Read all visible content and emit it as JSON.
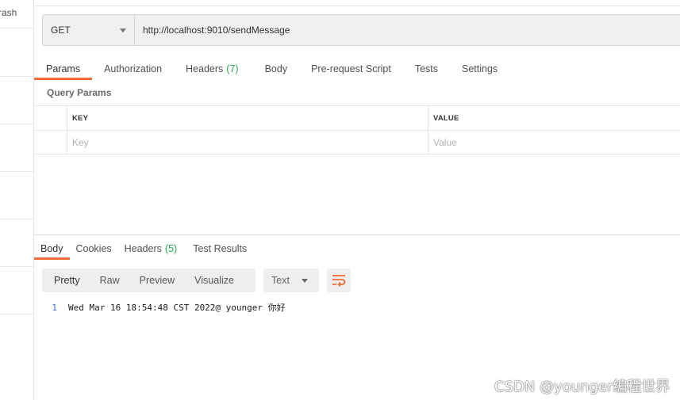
{
  "sidebar": {
    "partial_label": "rash"
  },
  "request": {
    "method": "GET",
    "url": "http://localhost:9010/sendMessage",
    "tabs": [
      {
        "label": "Params",
        "count": ""
      },
      {
        "label": "Authorization",
        "count": ""
      },
      {
        "label": "Headers",
        "count": "(7)"
      },
      {
        "label": "Body",
        "count": ""
      },
      {
        "label": "Pre-request Script",
        "count": ""
      },
      {
        "label": "Tests",
        "count": ""
      },
      {
        "label": "Settings",
        "count": ""
      }
    ],
    "query_params_title": "Query Params",
    "table": {
      "headers": {
        "key": "KEY",
        "value": "VALUE"
      },
      "placeholders": {
        "key": "Key",
        "value": "Value"
      }
    }
  },
  "response": {
    "tabs": [
      {
        "label": "Body",
        "count": ""
      },
      {
        "label": "Cookies",
        "count": ""
      },
      {
        "label": "Headers",
        "count": "(5)"
      },
      {
        "label": "Test Results",
        "count": ""
      }
    ],
    "view_modes": [
      "Pretty",
      "Raw",
      "Preview",
      "Visualize"
    ],
    "format": "Text",
    "lines": [
      {
        "number": "1",
        "text": "Wed Mar 16 18:54:48 CST 2022@ younger 你好"
      }
    ]
  },
  "watermark": "CSDN @younger编程世界",
  "colors": {
    "accent": "#f26b3a",
    "count_green": "#26a84f",
    "line_number": "#3b72c4"
  },
  "icons": {
    "wrap": "wrap-lines-icon",
    "method_caret": "chevron-down-icon"
  }
}
